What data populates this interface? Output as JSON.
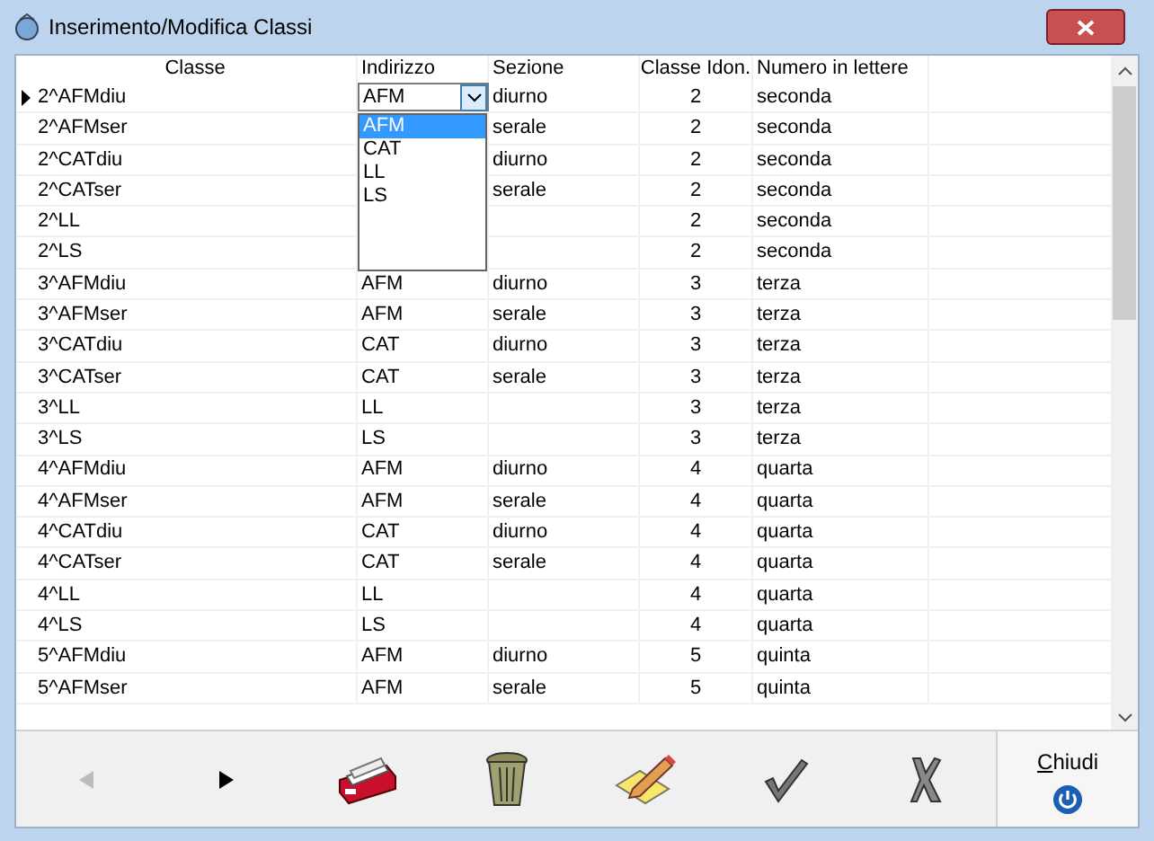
{
  "window": {
    "title": "Inserimento/Modifica Classi"
  },
  "table": {
    "columns": [
      "Classe",
      "Indirizzo",
      "Sezione",
      "Classe Idon.",
      "Numero in lettere"
    ],
    "rows": [
      {
        "current": true,
        "classe": "2^AFMdiu",
        "indirizzo": "AFM",
        "sezione": "diurno",
        "idon": "2",
        "lettere": "seconda"
      },
      {
        "current": false,
        "classe": "2^AFMser",
        "sezione": "serale",
        "idon": "2",
        "lettere": "seconda"
      },
      {
        "current": false,
        "classe": "2^CATdiu",
        "sezione": "diurno",
        "idon": "2",
        "lettere": "seconda"
      },
      {
        "current": false,
        "classe": "2^CATser",
        "sezione": "serale",
        "idon": "2",
        "lettere": "seconda"
      },
      {
        "current": false,
        "classe": "2^LL",
        "idon": "2",
        "lettere": "seconda"
      },
      {
        "current": false,
        "classe": "2^LS",
        "idon": "2",
        "lettere": "seconda"
      },
      {
        "current": false,
        "classe": "3^AFMdiu",
        "indirizzo": "AFM",
        "sezione": "diurno",
        "idon": "3",
        "lettere": "terza"
      },
      {
        "current": false,
        "classe": "3^AFMser",
        "indirizzo": "AFM",
        "sezione": "serale",
        "idon": "3",
        "lettere": "terza"
      },
      {
        "current": false,
        "classe": "3^CATdiu",
        "indirizzo": "CAT",
        "sezione": "diurno",
        "idon": "3",
        "lettere": "terza"
      },
      {
        "current": false,
        "classe": "3^CATser",
        "indirizzo": "CAT",
        "sezione": "serale",
        "idon": "3",
        "lettere": "terza"
      },
      {
        "current": false,
        "classe": "3^LL",
        "indirizzo": "LL",
        "idon": "3",
        "lettere": "terza"
      },
      {
        "current": false,
        "classe": "3^LS",
        "indirizzo": "LS",
        "idon": "3",
        "lettere": "terza"
      },
      {
        "current": false,
        "classe": "4^AFMdiu",
        "indirizzo": "AFM",
        "sezione": "diurno",
        "idon": "4",
        "lettere": "quarta"
      },
      {
        "current": false,
        "classe": "4^AFMser",
        "indirizzo": "AFM",
        "sezione": "serale",
        "idon": "4",
        "lettere": "quarta"
      },
      {
        "current": false,
        "classe": "4^CATdiu",
        "indirizzo": "CAT",
        "sezione": "diurno",
        "idon": "4",
        "lettere": "quarta"
      },
      {
        "current": false,
        "classe": "4^CATser",
        "indirizzo": "CAT",
        "sezione": "serale",
        "idon": "4",
        "lettere": "quarta"
      },
      {
        "current": false,
        "classe": "4^LL",
        "indirizzo": "LL",
        "idon": "4",
        "lettere": "quarta"
      },
      {
        "current": false,
        "classe": "4^LS",
        "indirizzo": "LS",
        "idon": "4",
        "lettere": "quarta"
      },
      {
        "current": false,
        "classe": "5^AFMdiu",
        "indirizzo": "AFM",
        "sezione": "diurno",
        "idon": "5",
        "lettere": "quinta"
      },
      {
        "current": false,
        "classe": "5^AFMser",
        "indirizzo": "AFM",
        "sezione": "serale",
        "idon": "5",
        "lettere": "quinta"
      }
    ]
  },
  "dropdown": {
    "options": [
      {
        "label": "AFM",
        "selected": true
      },
      {
        "label": "CAT",
        "selected": false
      },
      {
        "label": "LL",
        "selected": false
      },
      {
        "label": "LS",
        "selected": false
      }
    ]
  },
  "toolbar": [
    {
      "kind": "prev",
      "disabled": true
    },
    {
      "kind": "next",
      "disabled": false
    },
    {
      "kind": "cards",
      "disabled": false
    },
    {
      "kind": "trash",
      "disabled": false
    },
    {
      "kind": "edit",
      "disabled": false
    },
    {
      "kind": "confirm",
      "disabled": false
    },
    {
      "kind": "cancel",
      "disabled": false
    },
    {
      "kind": "close",
      "disabled": false,
      "label": "Chiudi"
    }
  ]
}
